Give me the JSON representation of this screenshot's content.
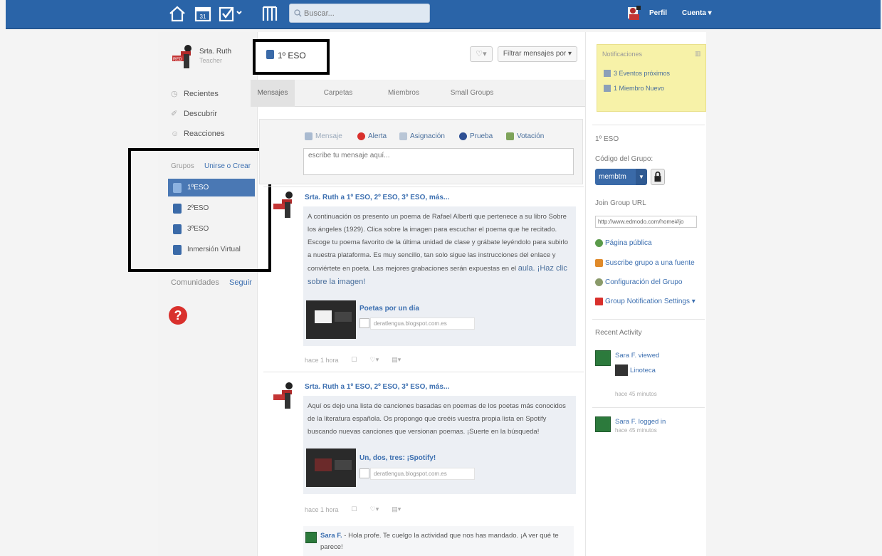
{
  "topbar": {
    "search_placeholder": "Buscar...",
    "calendar_day": "31",
    "profile_label": "Perfil",
    "account_label": "Cuenta ▾"
  },
  "sidebar": {
    "user_name": "Srta. Ruth",
    "user_role": "Teacher",
    "nav": [
      "Recientes",
      "Descubrir",
      "Reacciones"
    ],
    "groups_label": "Grupos",
    "join_create_label": "Unirse o Crear",
    "groups": [
      "1ºESO",
      "2ºESO",
      "3ºESO",
      "Inmersión Virtual"
    ],
    "communities_label": "Comunidades",
    "follow_label": "Seguir",
    "help_glyph": "?"
  },
  "main": {
    "group_title": "1º ESO",
    "tag_button": "♡▾",
    "filter_label": "Filtrar mensajes por ▾",
    "tabs": [
      "Mensajes",
      "Carpetas",
      "Miembros",
      "Small Groups"
    ],
    "composer": {
      "types": [
        "Mensaje",
        "Alerta",
        "Asignación",
        "Prueba",
        "Votación"
      ],
      "placeholder": "escribe tu mensaje aquí..."
    },
    "posts": [
      {
        "author": "Srta. Ruth a 1º ESO, 2º ESO, 3º ESO, más...",
        "text": "A continuación os presento un poema de Rafael Alberti que pertenece a su libro Sobre los ángeles (1929). Clica sobre la imagen para escuchar el poema que he recitado. Escoge tu poema favorito de la última unidad de clase y grábate leyéndolo para subirlo a nuestra plataforma. Es muy sencillo, tan solo sigue las instrucciones del enlace y conviértete en poeta. Las mejores grabaciones serán expuestas en el",
        "text_highlight": "aula. ¡Haz clic sobre la imagen!",
        "link_title": "Poetas por un día",
        "link_domain": "deratlengua.blogspot.com.es",
        "time": "hace 1 hora"
      },
      {
        "author": "Srta. Ruth a 1º ESO, 2º ESO, 3º ESO, más...",
        "text": "Aquí os dejo una lista de canciones basadas en poemas de los poetas más conocidos de la literatura española. Os propongo que creéis vuestra propia lista en Spotify buscando nuevas canciones que versionan poemas. ¡Suerte en la búsqueda!",
        "link_title": "Un, dos, tres: ¡Spotify!",
        "link_domain": "deratlengua.blogspot.com.es",
        "time": "hace 1 hora"
      }
    ],
    "reply": {
      "name": "Sara F.",
      "text": " - Hola profe. Te cuelgo la actividad que nos has mandado. ¡A ver qué te parece!"
    }
  },
  "right": {
    "notifications_title": "Notificaciones",
    "notifications": [
      "3 Eventos próximos",
      "1 Miembro Nuevo"
    ],
    "group_name": "1º ESO",
    "code_label": "Código del Grupo:",
    "code_value": "membtm",
    "join_url_label": "Join Group URL",
    "join_url": "http://www.edmodo.com/home#/jo",
    "links": [
      "Página pública",
      "Suscribe grupo a una fuente",
      "Configuración del Grupo",
      "Group Notification Settings ▾"
    ],
    "recent_activity_label": "Recent Activity",
    "activity": [
      {
        "name": "Sara F. viewed",
        "item": "Linoteca",
        "time": "hace 45 minutos"
      },
      {
        "name": "Sara F. logged in",
        "time": "hace 45 minutos"
      }
    ]
  },
  "colors": {
    "topbar": "#2a64a8",
    "accent": "#3a6aa8",
    "note": "#f7f2a8",
    "alert_red": "#d9302c"
  }
}
